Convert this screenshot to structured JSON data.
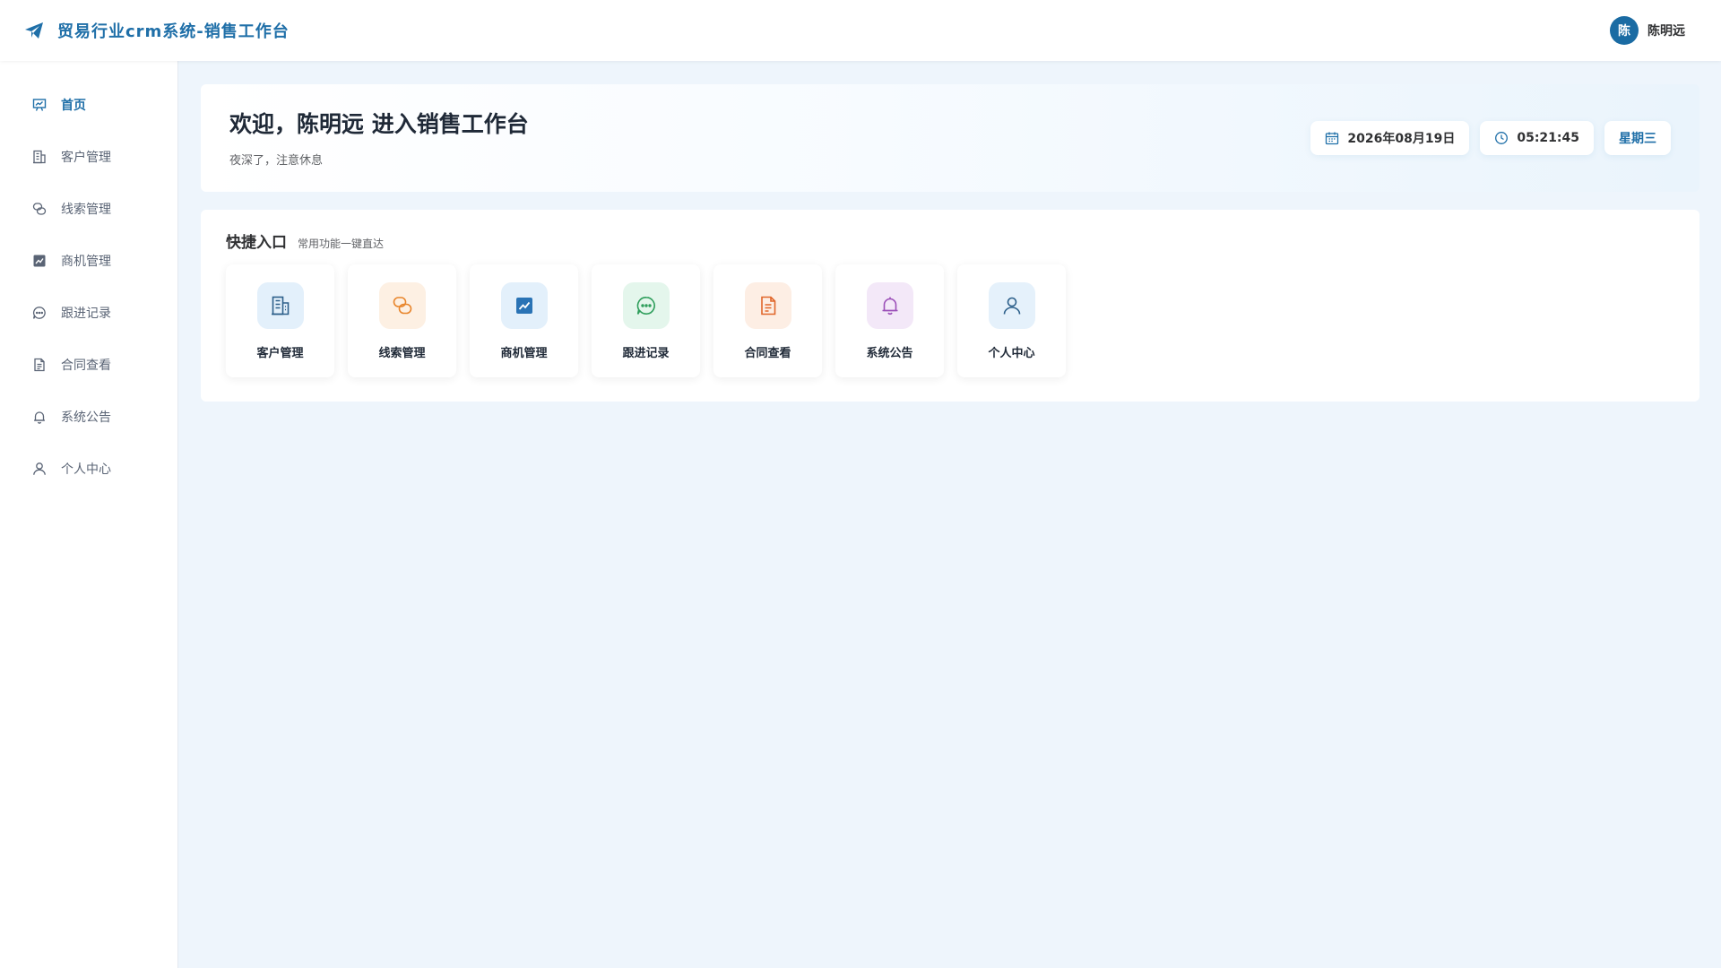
{
  "header": {
    "title": "贸易行业crm系统-销售工作台",
    "brand_icon": "paper-plane-icon",
    "user": {
      "avatar_text": "陈",
      "name": "陈明远"
    }
  },
  "sidebar": {
    "items": [
      {
        "label": "首页",
        "icon": "presentation-board-icon",
        "active": true
      },
      {
        "label": "客户管理",
        "icon": "building-icon"
      },
      {
        "label": "线索管理",
        "icon": "chat-bubbles-icon"
      },
      {
        "label": "商机管理",
        "icon": "trend-chart-icon"
      },
      {
        "label": "跟进记录",
        "icon": "comment-dots-icon"
      },
      {
        "label": "合同查看",
        "icon": "document-icon"
      },
      {
        "label": "系统公告",
        "icon": "bell-icon"
      },
      {
        "label": "个人中心",
        "icon": "user-icon"
      }
    ]
  },
  "welcome": {
    "title": "欢迎，陈明远 进入销售工作台",
    "subtitle": "夜深了，注意休息",
    "date": "2026年08月19日",
    "time": "05:21:45",
    "weekday": "星期三"
  },
  "quick": {
    "title": "快捷入口",
    "subtitle": "常用功能一键直达",
    "tiles": [
      {
        "label": "客户管理",
        "icon": "building-icon",
        "bg": "#e3f0fb",
        "color": "#2c5f8a"
      },
      {
        "label": "线索管理",
        "icon": "chat-bubbles-icon",
        "bg": "#fdf0e3",
        "color": "#e8852b"
      },
      {
        "label": "商机管理",
        "icon": "trend-chart-icon",
        "bg": "#e3f0fb",
        "color": "#2a73b5"
      },
      {
        "label": "跟进记录",
        "icon": "comment-dots-icon",
        "bg": "#e4f6ec",
        "color": "#2e9e5b"
      },
      {
        "label": "合同查看",
        "icon": "document-icon",
        "bg": "#fdeee4",
        "color": "#e0662a"
      },
      {
        "label": "系统公告",
        "icon": "bell-icon",
        "bg": "#f3e8f8",
        "color": "#9b4fb8"
      },
      {
        "label": "个人中心",
        "icon": "user-icon",
        "bg": "#e5f1fb",
        "color": "#2c5f8a"
      }
    ]
  },
  "colors": {
    "primary": "#1f6fa8",
    "avatar": "#1a6ba3",
    "page_bg": "#eef5fc",
    "nav_text": "#5a6475"
  }
}
